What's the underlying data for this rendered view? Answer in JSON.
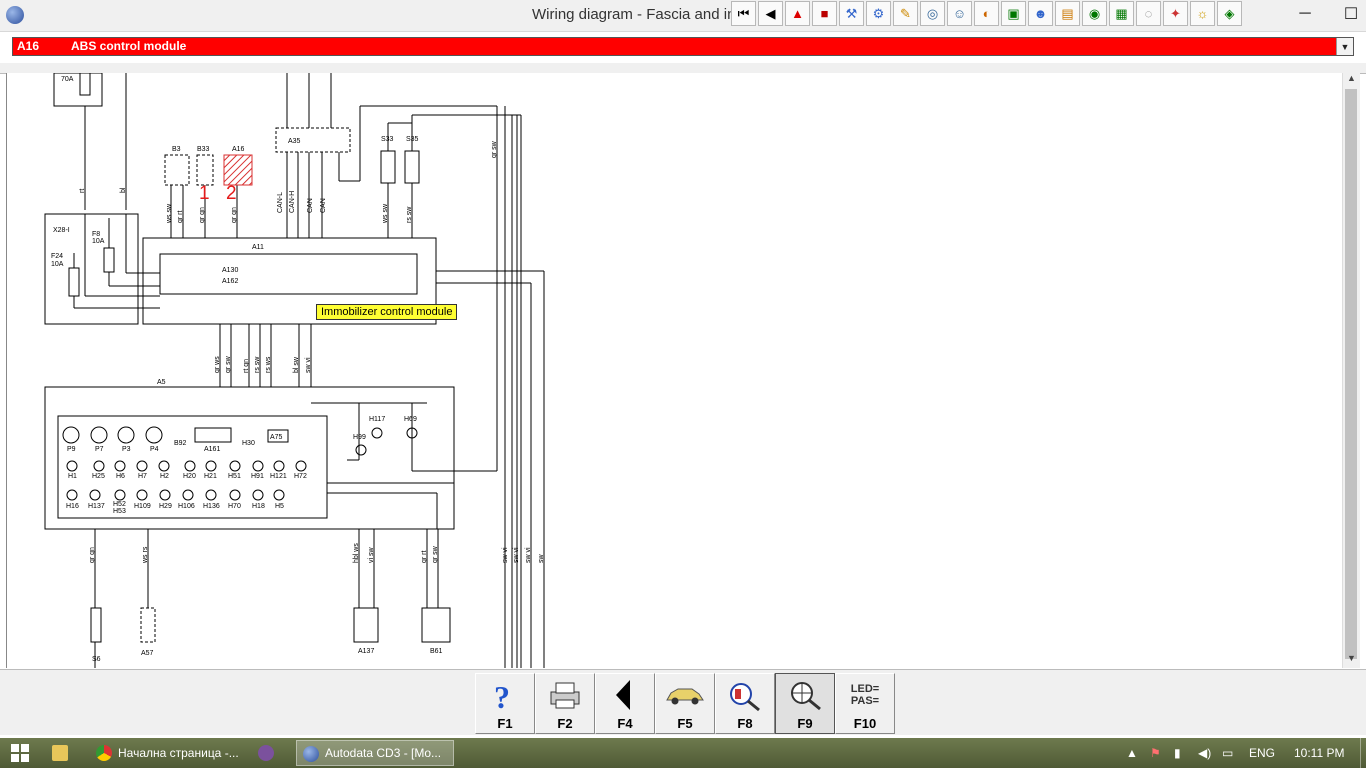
{
  "window": {
    "title": "Wiring diagram - Fascia and in",
    "minimize": "─",
    "maximize": "☐",
    "close": "✕"
  },
  "toolbar": {
    "icons": [
      "first-page-icon",
      "previous-icon",
      "warning-icon",
      "component-icon",
      "tool-icon",
      "engine-icon",
      "wrench-icon",
      "settings-icon",
      "person-icon",
      "gauge-icon",
      "car-icon",
      "person-run-icon",
      "document-icon",
      "tyre-icon",
      "airbag-icon",
      "disc-icon",
      "ac-icon",
      "key-icon",
      "grid-icon"
    ]
  },
  "selector": {
    "code": "A16",
    "name": "ABS control module"
  },
  "diagram": {
    "marks": {
      "one": "1",
      "two": "2"
    },
    "tooltip": "Immobilizer control module",
    "fuse_70a": "70A",
    "x28": "X28-I",
    "f8": "F8",
    "f8_value": "10A",
    "f24": "F24",
    "f24_value": "10A",
    "b3": "B3",
    "b33": "B33",
    "a16": "A16",
    "a35": "A35",
    "s33": "S33",
    "s35": "S35",
    "a11": "A11",
    "a130": "A130",
    "a162": "A162",
    "a5": "A5",
    "can_labels": [
      "CAN-L",
      "CAN-H",
      "CAN",
      "CAN"
    ],
    "cluster_row1": [
      "P9",
      "P7",
      "P3",
      "P4",
      "B92",
      "A161",
      "H30",
      "A75"
    ],
    "cluster_row2": [
      "H1",
      "H25",
      "H6",
      "H7",
      "H2",
      "H20",
      "H21",
      "H51",
      "H91",
      "H121",
      "H72"
    ],
    "cluster_row3": [
      "H16",
      "H137",
      "H52",
      "H53",
      "H109",
      "H29",
      "H106",
      "H136",
      "H70",
      "H18",
      "H5"
    ],
    "lamps": [
      "H99",
      "H117",
      "H69"
    ],
    "s6": "S6",
    "a57": "A57",
    "a137": "A137",
    "b61": "B61",
    "wire_colors": [
      "ws sw",
      "gr rt",
      "gr gn",
      "gr gn",
      "ws sw",
      "rs sw",
      "gr sw",
      "sw vi",
      "sw vi",
      "sw vi",
      "sw",
      "gr ws",
      "gr sw",
      "rt gn",
      "rs sw",
      "rs ws",
      "bl sw",
      "sw vi",
      "gr gn",
      "ws rs",
      "hbl ws",
      "vi sw",
      "gr rt",
      "gr sw",
      "rt",
      "bl",
      "ws"
    ]
  },
  "fkeys": [
    {
      "key": "F1",
      "icon": "help-icon"
    },
    {
      "key": "F2",
      "icon": "print-icon"
    },
    {
      "key": "F4",
      "icon": "back-icon"
    },
    {
      "key": "F5",
      "icon": "car-icon"
    },
    {
      "key": "F8",
      "icon": "component-zoom-icon"
    },
    {
      "key": "F9",
      "icon": "locate-icon"
    },
    {
      "key": "F10",
      "icon": "led-pas-icon",
      "line1": "LED=",
      "line2": "PAS="
    }
  ],
  "taskbar": {
    "task1": "Начална страница -...",
    "task2": "Autodata CD3 - [Mo...",
    "language": "ENG",
    "time": "10:11 PM"
  }
}
